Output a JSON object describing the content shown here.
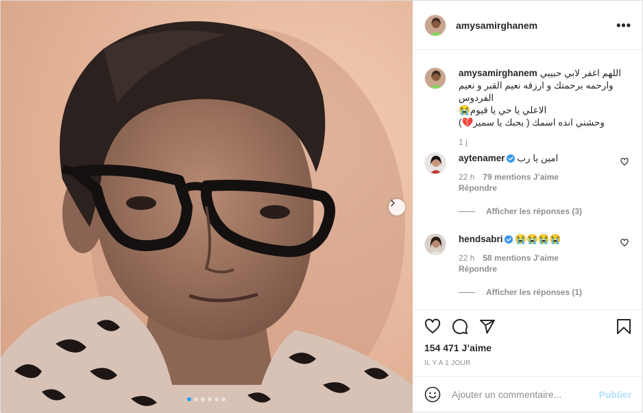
{
  "post": {
    "author": "amysamirghanem",
    "more_label": "•••",
    "colors": {
      "accent": "#0095f6",
      "publish_disabled": "#b2dffc",
      "verified": "#3897f0",
      "muted": "#8e8e8e"
    }
  },
  "caption": {
    "user": "amysamirghanem",
    "lines": [
      "اللهم اغفر لابي حبيبي",
      "وارحمه برحمتك و ارزقه نعيم القبر و نعيم الفردوس",
      "الاعلي يا حي يا قيوم😭",
      "وحشني انده اسمك ( بحبك يا سمير💔)"
    ],
    "time": "1 j"
  },
  "comments": [
    {
      "user": "aytenamer",
      "text": "امين يا رب",
      "time": "22 h",
      "likes": "79 mentions J’aime",
      "reply": "Répondre",
      "view_replies": "Afficher les réponses (3)"
    },
    {
      "user": "hendsabri",
      "text": "😭😭😭😭",
      "time": "22 h",
      "likes": "58 mentions J’aime",
      "reply": "Répondre",
      "view_replies": "Afficher les réponses (1)"
    }
  ],
  "stats": {
    "likes": "154 471 J’aime",
    "time": "IL Y A 1 JOUR"
  },
  "composer": {
    "placeholder": "Ajouter un commentaire...",
    "publish": "Publier"
  },
  "carousel": {
    "slide_count": 6,
    "current_slide": 1
  },
  "icons": [
    "chevron-right-icon",
    "more-icon",
    "verified-icon",
    "heart-icon",
    "comment-icon",
    "share-icon",
    "bookmark-icon",
    "emoji-icon"
  ]
}
